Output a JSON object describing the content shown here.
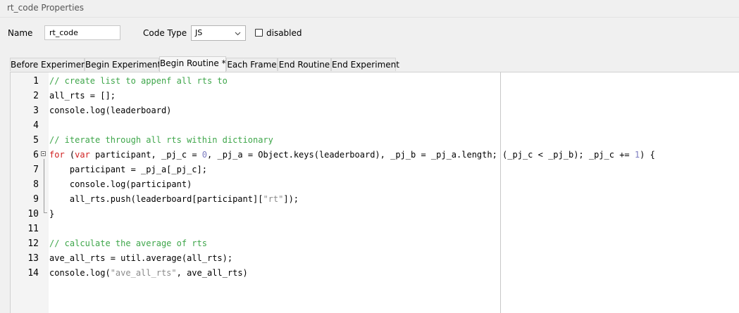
{
  "window": {
    "title": "rt_code Properties"
  },
  "form": {
    "name_label": "Name",
    "name_value": "rt_code",
    "code_type_label": "Code Type",
    "code_type_value": "JS",
    "disabled_label": "disabled",
    "disabled_checked": false
  },
  "tabs": [
    {
      "label": "Before Experiment",
      "active": false
    },
    {
      "label": "Begin Experiment",
      "active": false
    },
    {
      "label": "Begin Routine *",
      "active": true
    },
    {
      "label": "Each Frame",
      "active": false
    },
    {
      "label": "End Routine",
      "active": false
    },
    {
      "label": "End Experiment",
      "active": false
    }
  ],
  "editor": {
    "lines": [
      {
        "num": "1",
        "text": "// create list to appenf all rts to"
      },
      {
        "num": "2",
        "text": "all_rts = [];"
      },
      {
        "num": "3",
        "text": "console.log(leaderboard)"
      },
      {
        "num": "4",
        "text": ""
      },
      {
        "num": "5",
        "text": "// iterate through all rts within dictionary"
      },
      {
        "num": "6",
        "text": "for (var participant, _pj_c = 0, _pj_a = Object.keys(leaderboard), _pj_b = _pj_a.length; (_pj_c < _pj_b); _pj_c += 1) {"
      },
      {
        "num": "7",
        "text": "    participant = _pj_a[_pj_c];"
      },
      {
        "num": "8",
        "text": "    console.log(participant)"
      },
      {
        "num": "9",
        "text": "    all_rts.push(leaderboard[participant][\"rt\"]);"
      },
      {
        "num": "10",
        "text": "}"
      },
      {
        "num": "11",
        "text": ""
      },
      {
        "num": "12",
        "text": "// calculate the average of rts"
      },
      {
        "num": "13",
        "text": "ave_all_rts = util.average(all_rts);"
      },
      {
        "num": "14",
        "text": "console.log(\"ave_all_rts\", ave_all_rts)"
      }
    ]
  },
  "colors": {
    "comment": "#3ea64a",
    "keyword": "#d02020",
    "number": "#7c7cc0",
    "string": "#8a8a8a"
  }
}
